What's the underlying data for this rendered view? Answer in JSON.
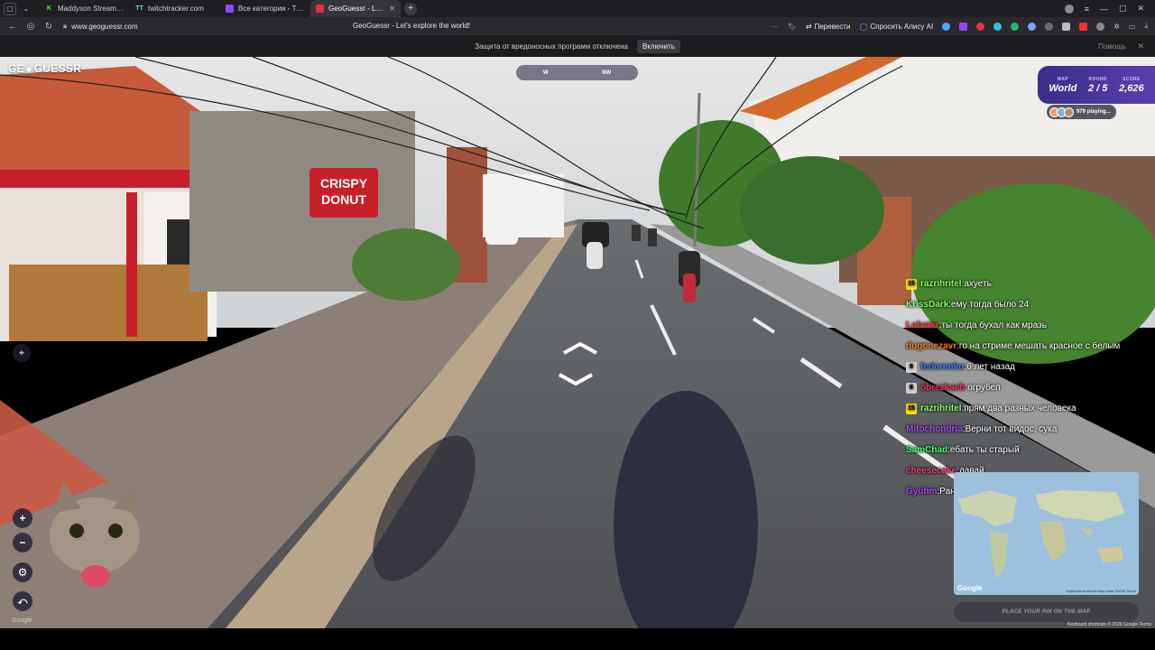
{
  "tabs": [
    {
      "label": "Maddyson Stream - Watch",
      "icon_color": "#53fc18",
      "icon_char": "K",
      "active": false
    },
    {
      "label": "twitchtracker.com",
      "icon_color": "#6ad0b6",
      "icon_char": "TT",
      "active": false
    },
    {
      "label": "Все категории - Twitch",
      "icon_color": "#9146ff",
      "icon_char": "",
      "active": false
    },
    {
      "label": "GeoGuessr - Let's explo",
      "icon_color": "#e8304a",
      "icon_char": "",
      "active": true
    }
  ],
  "address": {
    "url": "www.geoguessr.com",
    "page_title": "GeoGuessr - Let's explore the world!",
    "translate_label": "Перевести",
    "alice_label": "Спросить Алису AI"
  },
  "infobar": {
    "message": "Защита от вредоносных программ отключена",
    "enable_label": "Включить",
    "help_label": "Помощь"
  },
  "game": {
    "logo": "GE◉GUESSR",
    "compass": [
      "W",
      "NW"
    ],
    "hud": {
      "map_key": "MAP",
      "map_value": "World",
      "round_key": "ROUND",
      "round_value": "2 / 5",
      "score_key": "SCORE",
      "score_value": "2,626"
    },
    "players_text": "979 playing...",
    "shop_sign": "CRISPY DONUT",
    "guess_button": "PLACE YOUR PIN ON THE MAP",
    "minimap_google": "Google",
    "minimap_meta": "Keyboard shortcuts   Map Data ©2026   Terms",
    "legal": "Keyboard shortcuts  © 2026 Google  Terms",
    "google_watermark": "Google"
  },
  "chat": [
    {
      "badge": "15",
      "badge_color": "#ffe100",
      "user": "razrihritel",
      "user_color": "#7bff6a",
      "message": "ахуеть"
    },
    {
      "badge": "",
      "badge_color": "",
      "user": "KrissDark",
      "user_color": "#7bff6a",
      "message": "ему тогда было 24"
    },
    {
      "badge": "",
      "badge_color": "",
      "user": "Lobster",
      "user_color": "#ff3b3b",
      "message": "ты тогда бухал как мразь"
    },
    {
      "badge": "",
      "badge_color": "",
      "user": "dugonezavr",
      "user_color": "#ff7a1a",
      "message": "го на стриме мешать красное с белым"
    },
    {
      "badge": "8",
      "badge_color": "#d0d0d0",
      "user": "fedorenko",
      "user_color": "#3b7bff",
      "message": "6 лет назад"
    },
    {
      "badge": "8",
      "badge_color": "#d0d0d0",
      "user": "obrezkaeb",
      "user_color": "#ff2d55",
      "message": "огрубел"
    },
    {
      "badge": "15",
      "badge_color": "#ffe100",
      "user": "razrihritel",
      "user_color": "#7bff6a",
      "message": "прям два разных человека"
    },
    {
      "badge": "",
      "badge_color": "",
      "user": "Mitochondria",
      "user_color": "#a64dff",
      "message": "Верни тот видос, сука"
    },
    {
      "badge": "",
      "badge_color": "",
      "user": "SamChad",
      "user_color": "#3bff6a",
      "message": "ебать ты старый"
    },
    {
      "badge": "",
      "badge_color": "",
      "user": "cheesecake",
      "user_color": "#ff3b7a",
      "message": "давай"
    },
    {
      "badge": "",
      "badge_color": "",
      "user": "Gyuhm",
      "user_color": "#a64dff",
      "message": "Раньше были вампово"
    }
  ],
  "colors": {
    "hud_from": "#3a2e8a",
    "hud_to": "#5a3fb0",
    "shop_red": "#c8202a"
  }
}
